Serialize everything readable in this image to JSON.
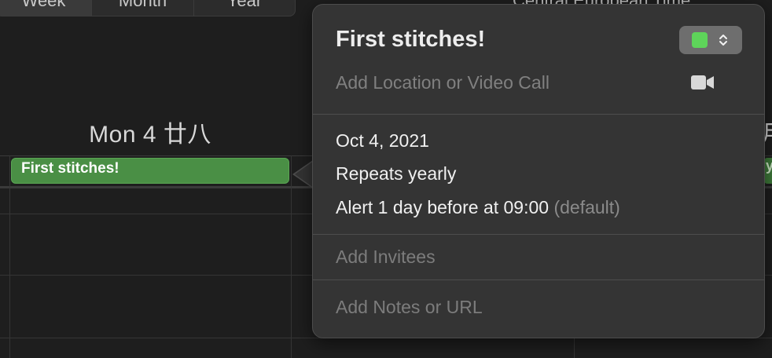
{
  "view_switcher": {
    "tabs": [
      "Week",
      "Month",
      "Year"
    ]
  },
  "timezone_label": "Central European Time",
  "day_header": {
    "label": "Mon 4 廿八"
  },
  "right_day_partial": "月",
  "right_event_partial": "y",
  "event_chip": {
    "title": "First stitches!",
    "color": "#4a8f45"
  },
  "popover": {
    "title": "First stitches!",
    "calendar_color": "#5ed45a",
    "location_placeholder": "Add Location or Video Call",
    "video_icon": "video-camera-icon",
    "date": "Oct 4, 2021",
    "repeat": "Repeats yearly",
    "alert": "Alert 1 day before at 09:00",
    "alert_note": "(default)",
    "invitees_placeholder": "Add Invitees",
    "notes_placeholder": "Add Notes or URL"
  }
}
